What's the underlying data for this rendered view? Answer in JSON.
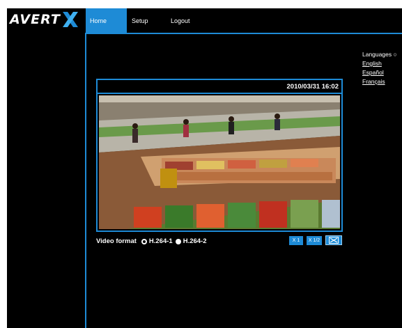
{
  "brand": {
    "logo_text": "AVERT",
    "accent": "#1e8bd6"
  },
  "nav": {
    "home": "Home",
    "setup": "Setup",
    "logout": "Logout"
  },
  "languages": {
    "title": "Languages",
    "items": [
      "English",
      "Español",
      "Français"
    ]
  },
  "viewer": {
    "timestamp": "2010/03/31 16:02"
  },
  "video_format": {
    "label": "Video format",
    "options": [
      {
        "label": "H.264-1",
        "selected": true
      },
      {
        "label": "H.264-2",
        "selected": false
      }
    ]
  },
  "zoom_buttons": {
    "x1": "X 1",
    "x12": "X 1/2",
    "fullscreen_icon": "fullscreen-icon"
  }
}
